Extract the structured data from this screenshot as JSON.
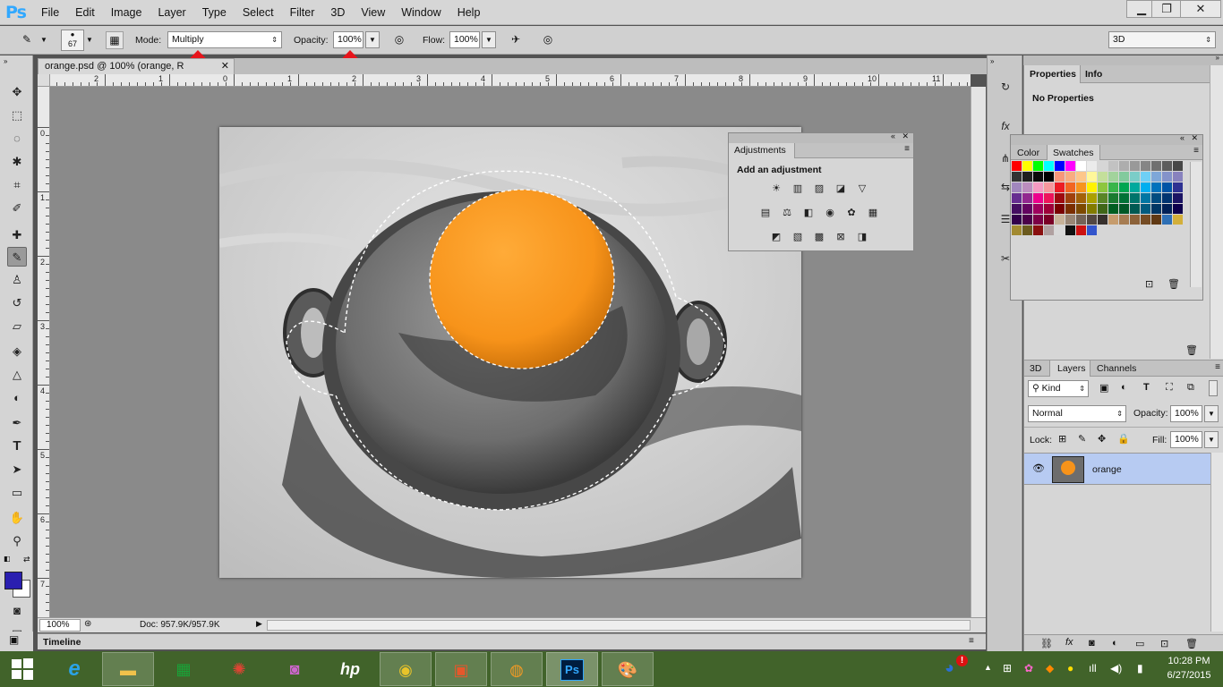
{
  "app": {
    "logo": "Ps",
    "menus": [
      "File",
      "Edit",
      "Image",
      "Layer",
      "Type",
      "Select",
      "Filter",
      "3D",
      "View",
      "Window",
      "Help"
    ],
    "window_controls": {
      "minimize": "▁",
      "restore": "❐",
      "close": "✕"
    }
  },
  "options_bar": {
    "brush_size": "67",
    "mode_label": "Mode:",
    "mode_value": "Multiply",
    "opacity_label": "Opacity:",
    "opacity_value": "100%",
    "flow_label": "Flow:",
    "flow_value": "100%",
    "workspace": "3D"
  },
  "document": {
    "tab_title": "orange.psd @ 100% (orange, R",
    "ruler_h": [
      "2",
      "1",
      "0",
      "1",
      "2",
      "3",
      "4",
      "5",
      "6",
      "7",
      "8",
      "9",
      "10",
      "11"
    ],
    "ruler_v": [
      "0",
      "1",
      "2",
      "3",
      "4",
      "5",
      "6",
      "7"
    ],
    "zoom": "100%",
    "doc_info": "Doc: 957.9K/957.9K"
  },
  "timeline": {
    "label": "Timeline"
  },
  "adjustments": {
    "tab": "Adjustments",
    "heading": "Add an adjustment",
    "row1": [
      "brightness-icon",
      "levels-icon",
      "curves-icon",
      "exposure-icon",
      "vibrance-icon"
    ],
    "row2": [
      "hue-saturation-icon",
      "color-balance-icon",
      "black-white-icon",
      "photo-filter-icon",
      "channel-mixer-icon",
      "color-lookup-icon"
    ],
    "row3": [
      "invert-icon",
      "posterize-icon",
      "threshold-icon",
      "selective-color-icon",
      "gradient-map-icon"
    ]
  },
  "properties": {
    "tabs": [
      "Properties",
      "Info"
    ],
    "text": "No Properties"
  },
  "swatches": {
    "tabs": [
      "Color",
      "Swatches"
    ],
    "rows": [
      [
        "#ff0000",
        "#ffff00",
        "#00ff00",
        "#00ffff",
        "#0000ff",
        "#ff00ff",
        "#ffffff",
        "#ebebeb",
        "#d6d6d6",
        "#c2c2c2",
        "#adadad",
        "#999999",
        "#858585",
        "#707070",
        "#5c5c5c",
        "#474747"
      ],
      [
        "#333333",
        "#1f1f1f",
        "#0a0a0a",
        "#000000",
        "#f7977a",
        "#f9ad81",
        "#fdc68a",
        "#fff79a",
        "#c4df9b",
        "#a2d39c",
        "#82ca9d",
        "#7bcdc8",
        "#6ecff6",
        "#7ea7d8",
        "#8493ca",
        "#8882be"
      ],
      [
        "#a187be",
        "#bc8dbf",
        "#f49ac2",
        "#f6989d",
        "#ed1c24",
        "#f26522",
        "#f7941d",
        "#fff200",
        "#8dc63f",
        "#39b54a",
        "#00a651",
        "#00a99d",
        "#00aeef",
        "#0072bc",
        "#0054a6",
        "#2e3192"
      ],
      [
        "#662d91",
        "#92278f",
        "#ec008c",
        "#ed145b",
        "#9e0b0f",
        "#a0410d",
        "#a36209",
        "#aba000",
        "#598527",
        "#1a7b30",
        "#007236",
        "#00746b",
        "#0076a3",
        "#004b80",
        "#003471",
        "#1b1464"
      ],
      [
        "#440e62",
        "#630460",
        "#9e005d",
        "#9e0039",
        "#790000",
        "#7b2e00",
        "#7d4900",
        "#827b00",
        "#406618",
        "#005e20",
        "#005826",
        "#005952",
        "#005b7f",
        "#003663",
        "#002157",
        "#0d004c"
      ],
      [
        "#32004b",
        "#4b0049",
        "#7b0046",
        "#7a0026",
        "#c7b299",
        "#998675",
        "#736357",
        "#534741",
        "#37302d",
        "#c69c6d",
        "#a67c52",
        "#8c6239",
        "#754c24",
        "#603913",
        "#2e6fb4",
        "#d3af3a"
      ],
      [
        "#a28a31",
        "#6b5a1e",
        "#8a1010",
        "#b0a0a0",
        "#d8d8d8",
        "#111111",
        "#cc1111",
        "#3355cc"
      ]
    ]
  },
  "layers": {
    "tabs": [
      "3D",
      "Layers",
      "Channels"
    ],
    "filter": "Kind",
    "blend": "Normal",
    "opacity_label": "Opacity:",
    "opacity_value": "100%",
    "lock_label": "Lock:",
    "fill_label": "Fill:",
    "fill_value": "100%",
    "layer_name": "orange"
  },
  "taskbar": {
    "time": "10:28 PM",
    "date": "6/27/2015"
  },
  "colors": {
    "foreground": "#2a1fb0",
    "background": "#ffffff",
    "orange": "#f7931a",
    "annotation": "#e8141b",
    "taskbar": "#41632a"
  }
}
